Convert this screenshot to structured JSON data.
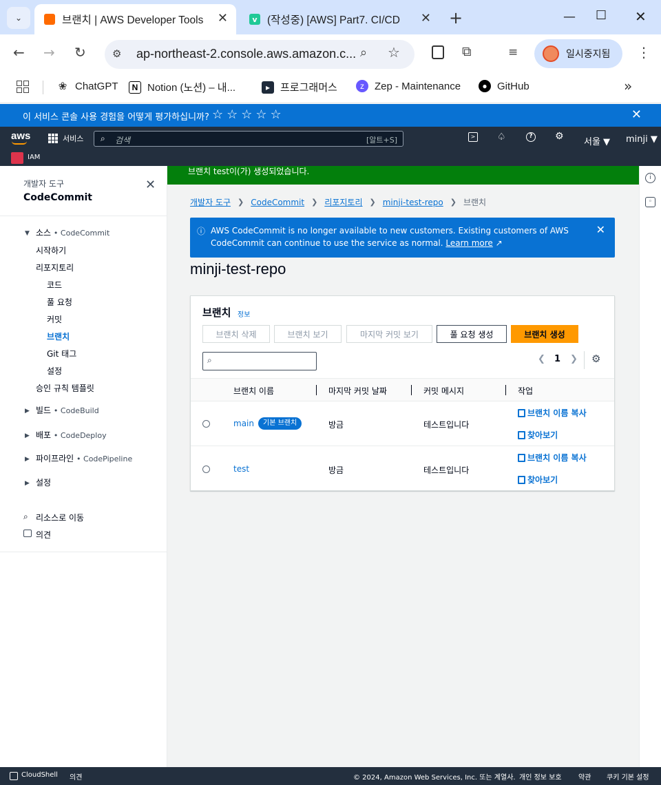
{
  "browser": {
    "tabs": [
      {
        "title": "브랜치 | AWS Developer Tools",
        "active": true
      },
      {
        "title": "(작성중) [AWS] Part7. CI/CD",
        "active": false
      }
    ],
    "url": "ap-northeast-2.console.aws.amazon.c...",
    "pause_label": "일시중지됨",
    "bookmarks": [
      {
        "label": "ChatGPT",
        "icon": "chatgpt-icon"
      },
      {
        "label": "Notion (노션) – 내...",
        "icon": "notion-icon"
      },
      {
        "label": "프로그래머스",
        "icon": "programmers-icon"
      },
      {
        "label": "Zep - Maintenance",
        "icon": "zep-icon"
      },
      {
        "label": "GitHub",
        "icon": "github-icon"
      }
    ],
    "more_bookmarks": "»"
  },
  "survey": {
    "question": "이 서비스 콘솔 사용 경험을 어떻게 평가하십니까?",
    "stars": "☆☆☆☆☆"
  },
  "aws_nav": {
    "logo": "aws",
    "services": "서비스",
    "search_placeholder": "검색",
    "search_shortcut": "[알트+S]",
    "region": "서울 ▼",
    "user": "minji ▼",
    "recent_service": "IAM"
  },
  "sidebar": {
    "breadcrumb": "개발자 도구",
    "title": "CodeCommit",
    "section_source": "소스",
    "section_source_sub": "• CodeCommit",
    "items": [
      "시작하기",
      "리포지토리",
      "코드",
      "풀 요청",
      "커밋",
      "브랜치",
      "Git 태그",
      "설정",
      "승인 규칙 템플릿"
    ],
    "sections": [
      {
        "label": "빌드",
        "sub": "• CodeBuild"
      },
      {
        "label": "배포",
        "sub": "• CodeDeploy"
      },
      {
        "label": "파이프라인",
        "sub": "• CodePipeline"
      },
      {
        "label": "설정",
        "sub": ""
      }
    ],
    "goto_resource": "리소스로 이동",
    "feedback": "의견"
  },
  "flash": {
    "message": "브랜치 test이(가) 생성되었습니다."
  },
  "breadcrumbs": [
    "개발자 도구",
    "CodeCommit",
    "리포지토리",
    "minji-test-repo",
    "브랜치"
  ],
  "alert": {
    "text": "AWS CodeCommit is no longer available to new customers. Existing customers of AWS CodeCommit can continue to use the service as normal.",
    "link": "Learn more"
  },
  "page_title": "minji-test-repo",
  "branches_panel": {
    "heading": "브랜치",
    "info": "정보",
    "buttons": {
      "delete": "브랜치 삭제",
      "view": "브랜치 보기",
      "last_commit": "마지막 커밋 보기",
      "pull_request": "풀 요청 생성",
      "create": "브랜치 생성"
    },
    "filter_value": "",
    "page": "1",
    "columns": [
      "브랜치 이름",
      "마지막 커밋 날짜",
      "커밋 메시지",
      "작업"
    ],
    "rows": [
      {
        "name": "main",
        "badge": "기본 브랜치",
        "date": "방금",
        "message": "테스트입니다",
        "action_copy": "브랜치 이름 복사",
        "action_browse": "찾아보기"
      },
      {
        "name": "test",
        "badge": "",
        "date": "방금",
        "message": "테스트입니다",
        "action_copy": "브랜치 이름 복사",
        "action_browse": "찾아보기"
      }
    ]
  },
  "footer": {
    "cloudshell": "CloudShell",
    "feedback": "의견",
    "copyright": "© 2024, Amazon Web Services, Inc. 또는 계열사.",
    "privacy": "개인 정보 보호",
    "terms": "약관",
    "cookies": "쿠키 기본 설정"
  },
  "colors": {
    "accent": "#0972d3",
    "nav": "#232f3e",
    "success": "#037f0c",
    "primary_button": "#ff9900"
  }
}
